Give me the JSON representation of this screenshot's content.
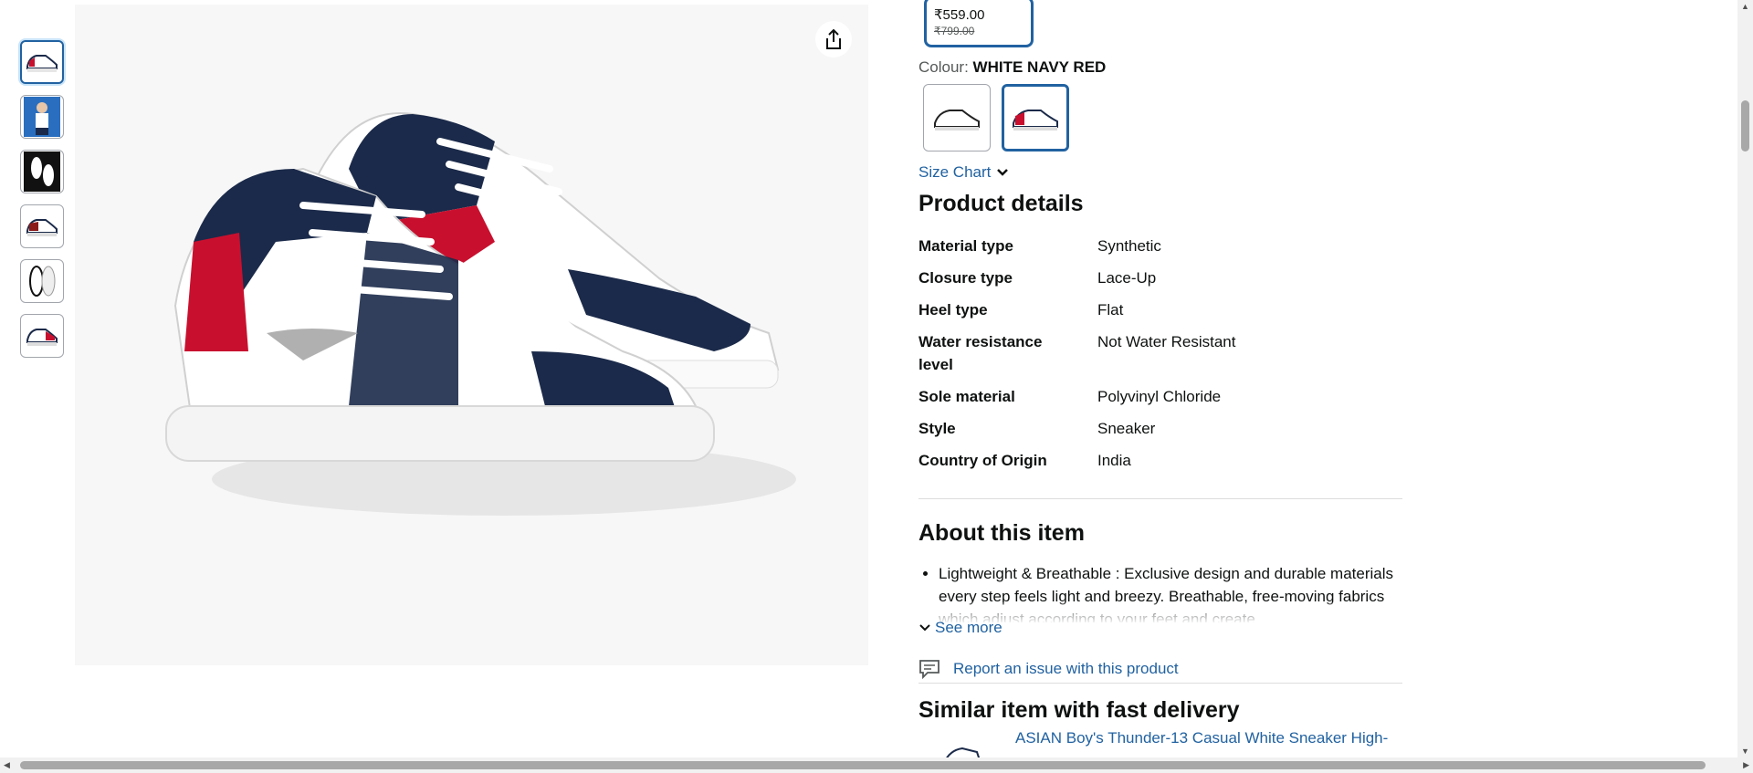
{
  "thumbnails": [
    {
      "name": "thumb-sneaker-side",
      "selected": true
    },
    {
      "name": "thumb-model-photo",
      "selected": false
    },
    {
      "name": "thumb-pair-top",
      "selected": false
    },
    {
      "name": "thumb-sneaker-side-2",
      "selected": false
    },
    {
      "name": "thumb-sole-view",
      "selected": false
    },
    {
      "name": "thumb-sneaker-angle",
      "selected": false
    }
  ],
  "price": {
    "current": "₹559.00",
    "original": "₹799.00"
  },
  "colour": {
    "label": "Colour:",
    "value": "WHITE NAVY RED"
  },
  "size_chart": "Size Chart",
  "product_details": {
    "heading": "Product details",
    "rows": [
      {
        "key": "Material type",
        "value": "Synthetic"
      },
      {
        "key": "Closure type",
        "value": "Lace-Up"
      },
      {
        "key": "Heel type",
        "value": "Flat"
      },
      {
        "key": "Water resistance level",
        "value": "Not Water Resistant"
      },
      {
        "key": "Sole material",
        "value": "Polyvinyl Chloride"
      },
      {
        "key": "Style",
        "value": "Sneaker"
      },
      {
        "key": "Country of Origin",
        "value": "India"
      }
    ]
  },
  "about": {
    "heading": "About this item",
    "bullet": "Lightweight & Breathable : Exclusive design and durable materials every step feels light and breezy. Breathable, free-moving fabrics which adjust according to your feet and create",
    "see_more": "See more"
  },
  "report_issue": "Report an issue with this product",
  "similar": {
    "heading": "Similar item with fast delivery",
    "title": "ASIAN Boy's Thunder-13 Casual White Sneaker High-"
  },
  "colors": {
    "link": "#2162a1",
    "selected_border": "#2162a1",
    "text": "#0f1111"
  }
}
